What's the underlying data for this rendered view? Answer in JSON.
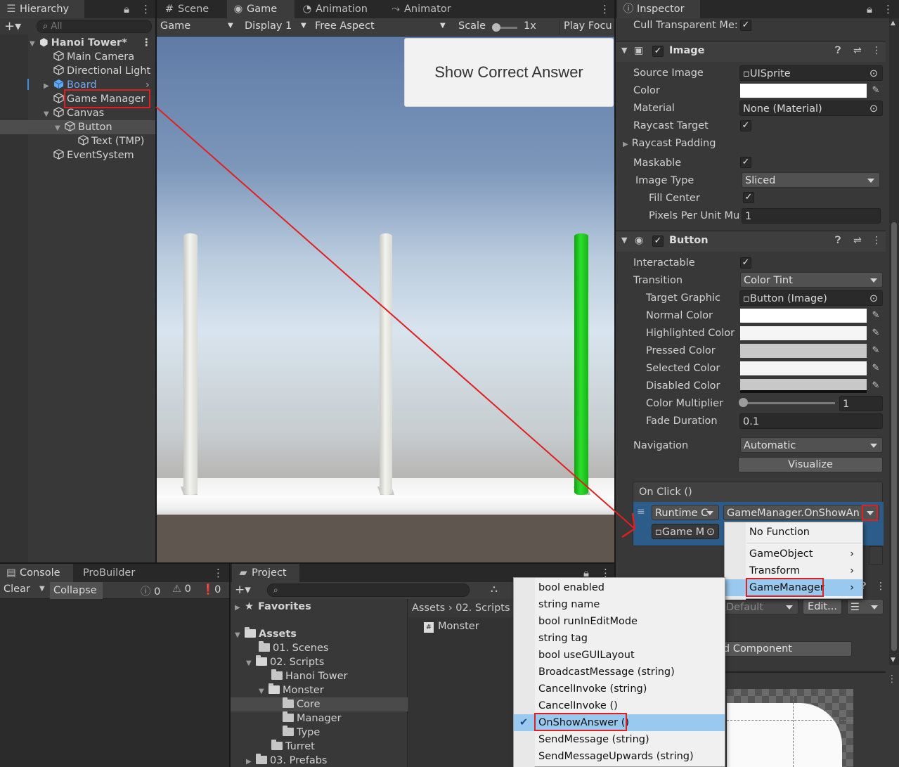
{
  "hierarchy": {
    "tab_label": "Hierarchy",
    "search_placeholder": "All",
    "scene_name": "Hanoi Tower*",
    "items": [
      "Main Camera",
      "Directional Light",
      "Board",
      "Game Manager",
      "Canvas",
      "Button",
      "Text (TMP)",
      "EventSystem"
    ]
  },
  "viewport": {
    "tabs": [
      "Scene",
      "Game",
      "Animation",
      "Animator"
    ],
    "toolbar": {
      "mode": "Game",
      "display": "Display 1",
      "aspect": "Free Aspect",
      "scale_label": "Scale",
      "scale_value": "1x",
      "play_focus": "Play Focu"
    },
    "button_text": "Show Correct Answer",
    "colors": {
      "sky_top": "#5f7ba6",
      "sky_horizon": "#d8e4ee",
      "ground": "#5f5650",
      "board": "#f0f0f0",
      "pole_white": "#e8e8e4",
      "pole_green": "#1ec21e"
    }
  },
  "console": {
    "tabs": [
      "Console",
      "ProBuilder"
    ],
    "clear": "Clear",
    "collapse": "Collapse",
    "counts": [
      "0",
      "0",
      "0"
    ]
  },
  "project": {
    "tab_label": "Project",
    "favorites": "Favorites",
    "assets": "Assets",
    "tree": [
      "01. Scenes",
      "02. Scripts",
      "Hanoi Tower",
      "Monster",
      "Core",
      "Manager",
      "Type",
      "Turret",
      "03. Prefabs"
    ],
    "breadcrumb": [
      "Assets",
      "02. Scripts"
    ],
    "files": [
      "Monster"
    ]
  },
  "inspector": {
    "tab_label": "Inspector",
    "cull_label": "Cull Transparent Me:",
    "image": {
      "title": "Image",
      "rows": {
        "source_image_label": "Source Image",
        "source_image_value": "UISprite",
        "color_label": "Color",
        "material_label": "Material",
        "material_value": "None (Material)",
        "raycast_target_label": "Raycast Target",
        "raycast_padding_label": "Raycast Padding",
        "maskable_label": "Maskable",
        "image_type_label": "Image Type",
        "image_type_value": "Sliced",
        "fill_center_label": "Fill Center",
        "ppu_label": "Pixels Per Unit Mu",
        "ppu_value": "1"
      }
    },
    "button": {
      "title": "Button",
      "interactable_label": "Interactable",
      "transition_label": "Transition",
      "transition_value": "Color Tint",
      "target_graphic_label": "Target Graphic",
      "target_graphic_value": "Button (Image)",
      "normal_label": "Normal Color",
      "highlighted_label": "Highlighted Color",
      "pressed_label": "Pressed Color",
      "selected_label": "Selected Color",
      "disabled_label": "Disabled Color",
      "multiplier_label": "Color Multiplier",
      "multiplier_value": "1",
      "fade_label": "Fade Duration",
      "fade_value": "0.1",
      "navigation_label": "Navigation",
      "navigation_value": "Automatic",
      "visualize": "Visualize"
    },
    "onclick": {
      "title": "On Click ()",
      "runtime": "Runtime C",
      "function": "GameManager.OnShowAn",
      "object": "Game M"
    },
    "material_row": {
      "shader_value": "Default",
      "edit": "Edit..."
    },
    "add_component": "d Component"
  },
  "function_menu": {
    "items": [
      "No Function",
      "GameObject",
      "Transform",
      "GameManager"
    ]
  },
  "submenu": {
    "items": [
      "bool enabled",
      "string name",
      "bool runInEditMode",
      "string tag",
      "bool useGUILayout",
      "BroadcastMessage (string)",
      "CancelInvoke (string)",
      "CancelInvoke ()",
      "OnShowAnswer ()",
      "SendMessage (string)",
      "SendMessageUpwards (string)"
    ]
  },
  "annotation_color": "#e02020"
}
